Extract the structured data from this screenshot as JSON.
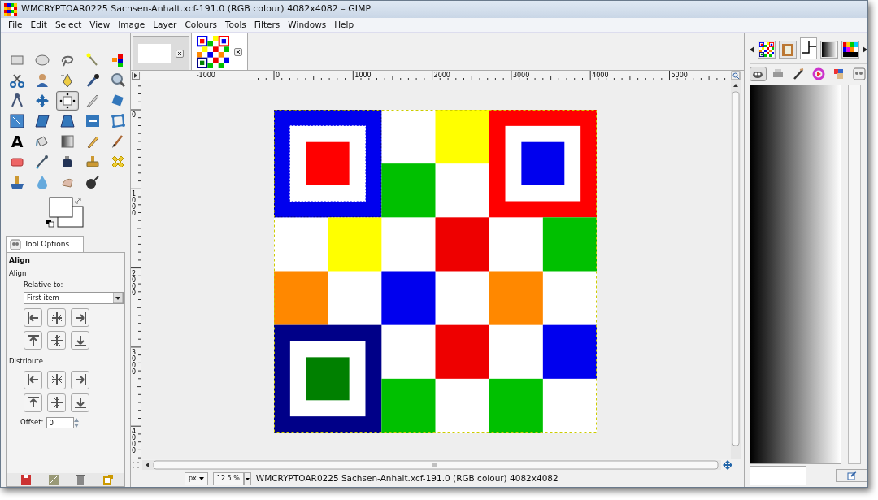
{
  "window": {
    "title": "WMCRYPTOAR0225 Sachsen-Anhalt.xcf-191.0 (RGB colour) 4082x4082 – GIMP"
  },
  "menu": [
    "File",
    "Edit",
    "Select",
    "View",
    "Image",
    "Layer",
    "Colours",
    "Tools",
    "Filters",
    "Windows",
    "Help"
  ],
  "toolbox": {
    "tools": [
      {
        "kind": "rect",
        "selected": false
      },
      {
        "kind": "ellipse",
        "selected": false
      },
      {
        "kind": "lasso",
        "selected": false
      },
      {
        "kind": "wand",
        "selected": false
      },
      {
        "kind": "bycolor",
        "selected": false
      },
      {
        "kind": "scissors",
        "selected": false
      },
      {
        "kind": "foreground",
        "selected": false
      },
      {
        "kind": "paths",
        "selected": false
      },
      {
        "kind": "picker",
        "selected": false
      },
      {
        "kind": "zoom",
        "selected": false
      },
      {
        "kind": "measure",
        "selected": false
      },
      {
        "kind": "move",
        "selected": false
      },
      {
        "kind": "align",
        "selected": true
      },
      {
        "kind": "crop",
        "selected": false
      },
      {
        "kind": "rotate",
        "selected": false
      },
      {
        "kind": "scale",
        "selected": false
      },
      {
        "kind": "shear",
        "selected": false
      },
      {
        "kind": "perspective",
        "selected": false
      },
      {
        "kind": "flip",
        "selected": false
      },
      {
        "kind": "cage",
        "selected": false
      },
      {
        "kind": "text",
        "glyph": "A",
        "selected": false
      },
      {
        "kind": "bucket",
        "selected": false
      },
      {
        "kind": "blend",
        "selected": false
      },
      {
        "kind": "pencil",
        "selected": false
      },
      {
        "kind": "brush",
        "selected": false
      },
      {
        "kind": "eraser",
        "selected": false
      },
      {
        "kind": "airbrush",
        "selected": false
      },
      {
        "kind": "ink",
        "selected": false
      },
      {
        "kind": "clone",
        "selected": false
      },
      {
        "kind": "heal",
        "selected": false
      },
      {
        "kind": "perspclone",
        "selected": false
      },
      {
        "kind": "blur",
        "selected": false
      },
      {
        "kind": "smudge",
        "selected": false
      },
      {
        "kind": "dodge",
        "selected": false
      }
    ]
  },
  "tool_options": {
    "tab": "Tool Options",
    "title": "Align",
    "section": "Align",
    "relative_label": "Relative to:",
    "relative_value": "First item",
    "distribute_label": "Distribute",
    "offset_label": "Offset:",
    "offset_value": "0"
  },
  "image_tabs": [
    {
      "kind": "blank",
      "selected": false
    },
    {
      "kind": "checker",
      "selected": true
    }
  ],
  "horizontal_ruler": {
    "labels": [
      "-1000",
      "0",
      "1000",
      "2000",
      "3000",
      "4000",
      "5000"
    ]
  },
  "vertical_ruler": {
    "labels": [
      "0",
      "1000",
      "2000",
      "3000",
      "4000"
    ]
  },
  "status_bar": {
    "unit": "px",
    "zoom": "12.5 %",
    "message": "WMCRYPTOAR0225 Sachsen-Anhalt.xcf-191.0 (RGB colour) 4082x4082"
  },
  "dock": {
    "tabs": [
      {
        "kind": "thumb",
        "selected": false
      },
      {
        "kind": "clipboard",
        "selected": false
      },
      {
        "kind": "pointer",
        "selected": true
      },
      {
        "kind": "gradient",
        "selected": false
      },
      {
        "kind": "palette",
        "selected": false
      }
    ],
    "icon_tabs": [
      {
        "kind": "wilber",
        "selected": true
      },
      {
        "kind": "printer",
        "selected": false
      },
      {
        "kind": "brush",
        "selected": false
      },
      {
        "kind": "wheel",
        "selected": false
      },
      {
        "kind": "colors",
        "selected": false
      },
      {
        "kind": "options",
        "selected": false
      }
    ]
  }
}
